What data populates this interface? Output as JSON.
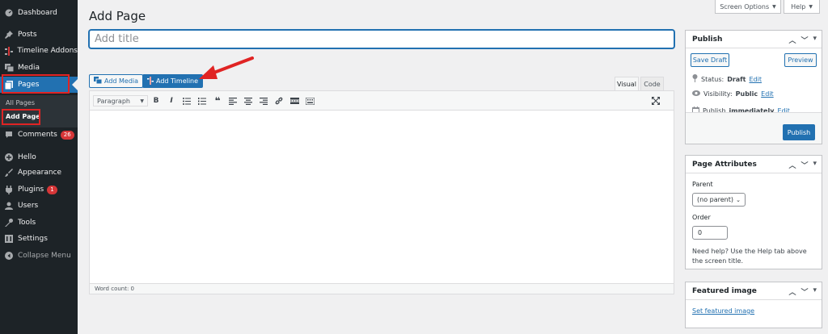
{
  "sidebar": {
    "items": [
      {
        "label": "Dashboard",
        "icon": "dashboard-icon"
      },
      {
        "label": "Posts",
        "icon": "pin-icon"
      },
      {
        "label": "Timeline Addons",
        "icon": "timeline-icon"
      },
      {
        "label": "Media",
        "icon": "media-icon"
      },
      {
        "label": "Pages",
        "icon": "pages-icon"
      },
      {
        "label": "Comments",
        "icon": "comment-icon",
        "badge": "26"
      },
      {
        "label": "Hello",
        "icon": "plus-circle-icon"
      },
      {
        "label": "Appearance",
        "icon": "brush-icon"
      },
      {
        "label": "Plugins",
        "icon": "plug-icon",
        "badge": "1"
      },
      {
        "label": "Users",
        "icon": "users-icon"
      },
      {
        "label": "Tools",
        "icon": "wrench-icon"
      },
      {
        "label": "Settings",
        "icon": "settings-icon"
      },
      {
        "label": "Collapse Menu",
        "icon": "collapse-icon"
      }
    ],
    "submenu": [
      "All Pages",
      "Add Page"
    ]
  },
  "top": {
    "screen_options": "Screen Options",
    "help": "Help"
  },
  "page": {
    "title": "Add Page",
    "title_placeholder": "Add title",
    "add_media": "Add Media",
    "add_timeline": "Add Timeline",
    "tab_visual": "Visual",
    "tab_code": "Code",
    "format_select": "Paragraph",
    "word_count": "Word count: 0"
  },
  "publish": {
    "title": "Publish",
    "save_draft": "Save Draft",
    "preview": "Preview",
    "status_label": "Status:",
    "status_value": "Draft",
    "visibility_label": "Visibility:",
    "visibility_value": "Public",
    "publish_label": "Publish",
    "publish_value": "immediately",
    "edit": "Edit",
    "publish_button": "Publish"
  },
  "attributes": {
    "title": "Page Attributes",
    "parent_label": "Parent",
    "parent_value": "(no parent)",
    "order_label": "Order",
    "order_value": "0",
    "help": "Need help? Use the Help tab above the screen title."
  },
  "featured": {
    "title": "Featured image",
    "link": "Set featured image"
  },
  "colors": {
    "accent": "#2271b1",
    "sidebar": "#1d2327",
    "highlight": "#e02424"
  }
}
